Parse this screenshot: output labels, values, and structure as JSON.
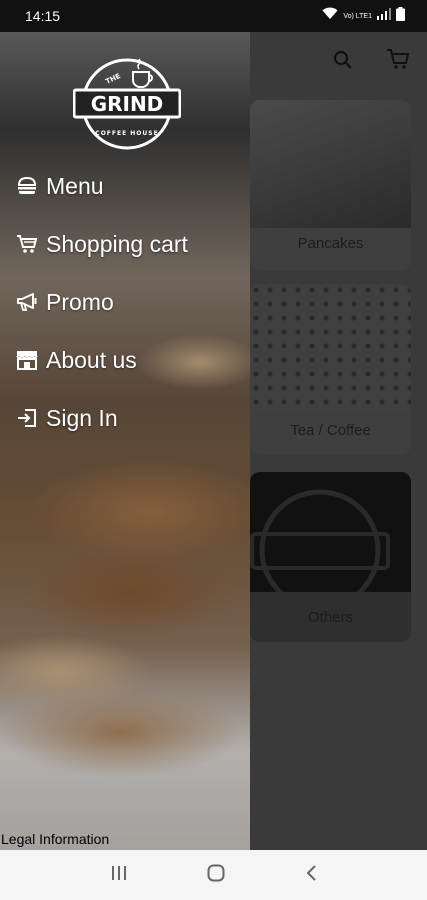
{
  "status_bar": {
    "time": "14:15",
    "network_label": "Vo) LTE1"
  },
  "drawer": {
    "brand": {
      "top": "THE",
      "name": "GRIND",
      "bottom": "COFFEE HOUSE"
    },
    "items": [
      {
        "label": "Menu",
        "icon": "burger-icon"
      },
      {
        "label": "Shopping cart",
        "icon": "cart-icon"
      },
      {
        "label": "Promo",
        "icon": "megaphone-icon"
      },
      {
        "label": "About us",
        "icon": "store-icon"
      },
      {
        "label": "Sign In",
        "icon": "sign-in-icon"
      }
    ],
    "legal": "Legal Information"
  },
  "background_screen": {
    "categories": [
      {
        "label": "Pancakes"
      },
      {
        "label": "Tea / Coffee"
      },
      {
        "label": "Others"
      }
    ]
  },
  "colors": {
    "scrim": "#3a3a3a",
    "drawer_text": "#ffffff",
    "nav_bar": "#f5f5f5"
  }
}
